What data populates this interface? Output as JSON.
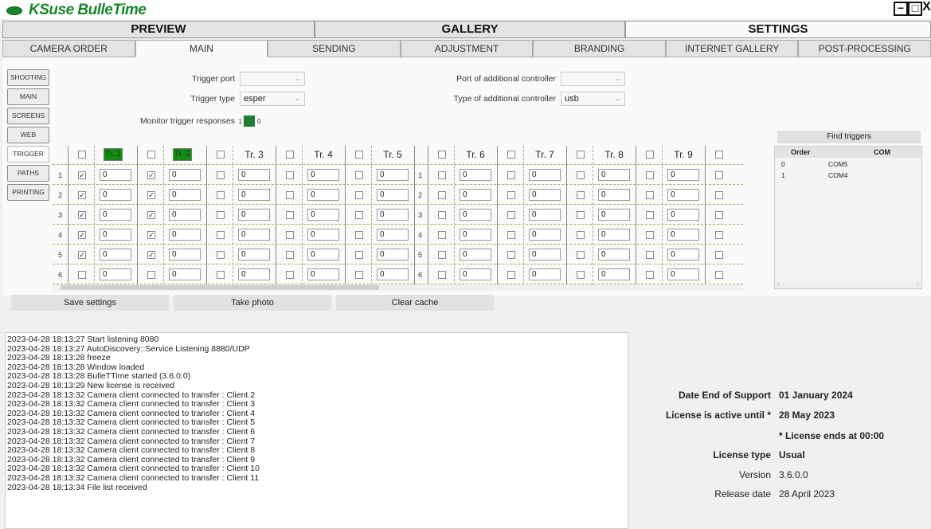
{
  "app": {
    "title": "KSuse BulleTime",
    "minimize": "−",
    "maximize": "□",
    "close": "X"
  },
  "main_tabs": [
    "PREVIEW",
    "GALLERY",
    "SETTINGS"
  ],
  "sub_tabs": [
    "CAMERA ORDER",
    "MAIN",
    "SENDING",
    "ADJUSTMENT",
    "BRANDING",
    "INTERNET GALLERY",
    "POST-PROCESSING"
  ],
  "side_menu": [
    "SHOOTING",
    "MAIN",
    "SCREENS",
    "WEB",
    "TRIGGER",
    "PATHS",
    "PRINTING"
  ],
  "trigger_settings": {
    "trigger_port_label": "Trigger port",
    "trigger_port_value": "",
    "trigger_type_label": "Trigger type",
    "trigger_type_value": "esper",
    "monitor_label": "Monitor trigger responses",
    "monitor_on": "1",
    "monitor_off": "0",
    "add_port_label": "Port of additional controller",
    "add_port_value": "",
    "add_type_label": "Type of additional controller",
    "add_type_value": "usb"
  },
  "trigger_grid": {
    "headers": [
      "Tr. 1",
      "Tr. 2",
      "Tr. 3",
      "Tr. 4",
      "Tr. 5",
      "Tr. 6",
      "Tr. 7",
      "Tr. 8",
      "Tr. 9"
    ],
    "highlighted": [
      true,
      true,
      false,
      false,
      false,
      false,
      false,
      false,
      false
    ],
    "row_numbers": [
      "1",
      "2",
      "3",
      "4",
      "5",
      "6"
    ],
    "cell_value": "0",
    "checked": [
      [
        true,
        true,
        true,
        true,
        true,
        false
      ],
      [
        true,
        true,
        true,
        true,
        true,
        false
      ],
      [
        false,
        false,
        false,
        false,
        false,
        false
      ],
      [
        false,
        false,
        false,
        false,
        false,
        false
      ],
      [
        false,
        false,
        false,
        false,
        false,
        false
      ],
      [
        false,
        false,
        false,
        false,
        false,
        false
      ],
      [
        false,
        false,
        false,
        false,
        false,
        false
      ],
      [
        false,
        false,
        false,
        false,
        false,
        false
      ],
      [
        false,
        false,
        false,
        false,
        false,
        false
      ]
    ]
  },
  "find_triggers": {
    "button": "Find triggers",
    "columns": [
      "Order",
      "COM"
    ],
    "rows": [
      [
        "0",
        "COM5"
      ],
      [
        "1",
        "COM4"
      ]
    ]
  },
  "actions": [
    "Save settings",
    "Take photo",
    "Clear cache"
  ],
  "log": [
    "2023-04-28 18:13:27 Start listening 8080",
    "2023-04-28 18:13:27 AutoDiscovery::Service Listening 8880/UDP",
    "2023-04-28 18:13:28 freeze",
    "2023-04-28 18:13:28 Window loaded",
    "2023-04-28 18:13:28 BulleTTime started (3.6.0.0)",
    "2023-04-28 18:13:29 New license is received",
    "2023-04-28 18:13:32 Camera client connected to transfer : Client 2",
    "2023-04-28 18:13:32 Camera client connected to transfer : Client 3",
    "2023-04-28 18:13:32 Camera client connected to transfer : Client 4",
    "2023-04-28 18:13:32 Camera client connected to transfer : Client 5",
    "2023-04-28 18:13:32 Camera client connected to transfer : Client 6",
    "2023-04-28 18:13:32 Camera client connected to transfer : Client 7",
    "2023-04-28 18:13:32 Camera client connected to transfer : Client 8",
    "2023-04-28 18:13:32 Camera client connected to transfer : Client 9",
    "2023-04-28 18:13:32 Camera client connected to transfer : Client 10",
    "2023-04-28 18:13:32 Camera client connected to transfer : Client 11",
    "2023-04-28 18:13:34 File list received"
  ],
  "license": {
    "support_label": "Date End of Support",
    "support_value": "01 January 2024",
    "active_label": "License is active until *",
    "active_value": "28 May 2023",
    "note": "* License ends at 00:00",
    "type_label": "License type",
    "type_value": "Usual",
    "version_label": "Version",
    "version_value": "3.6.0.0",
    "release_label": "Release date",
    "release_value": "28 April 2023"
  }
}
